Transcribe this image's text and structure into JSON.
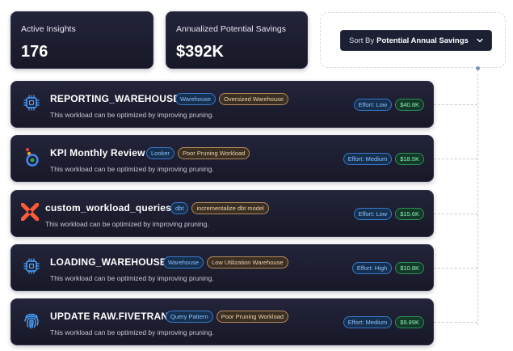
{
  "stats": [
    {
      "label": "Active Insights",
      "value": "176"
    },
    {
      "label": "Annualized Potential Savings",
      "value": "$392K"
    }
  ],
  "sort": {
    "prefix": "Sort By",
    "value": "Potential Annual Savings",
    "icon": "chevron-down-icon"
  },
  "cards": [
    {
      "title": "REPORTING_WAREHOUSE",
      "type": "Warehouse",
      "issue": "Oversized Warehouse",
      "description": "This workload can be optimized by improving pruning.",
      "effort": "Effort: Low",
      "savings": "$40.8K",
      "icon": "chip-icon"
    },
    {
      "title": "KPI Monthly Review",
      "type": "Looker",
      "issue": "Poor Pruning Workload",
      "description": "This workload can be optimized by improving pruning.",
      "effort": "Effort: Medium",
      "savings": "$18.5K",
      "icon": "looker-icon"
    },
    {
      "title": "custom_workload_queries",
      "type": "dbt",
      "issue": "incrementalize dbt model",
      "description": "This workload can be optimized by improving pruning.",
      "effort": "Effort: Low",
      "savings": "$15.6K",
      "icon": "dbt-icon"
    },
    {
      "title": "LOADING_WAREHOUSE",
      "type": "Warehouse",
      "issue": "Low Utilization Warehouse",
      "description": "This workload can be optimized by improving pruning.",
      "effort": "Effort: High",
      "savings": "$10.8K",
      "icon": "chip-icon"
    },
    {
      "title": "UPDATE RAW.FIVETRAN",
      "type": "Query Pattern",
      "issue": "Poor Pruning Workload",
      "description": "This workload can be optimized by improving pruning.",
      "effort": "Effort: Medium",
      "savings": "$9.89K",
      "icon": "fingerprint-icon"
    }
  ],
  "colors": {
    "card_bg": "#1b1c2e",
    "accent_blue": "#3a78c9",
    "accent_tan": "#b58b5c",
    "accent_green": "#2f8d58"
  }
}
